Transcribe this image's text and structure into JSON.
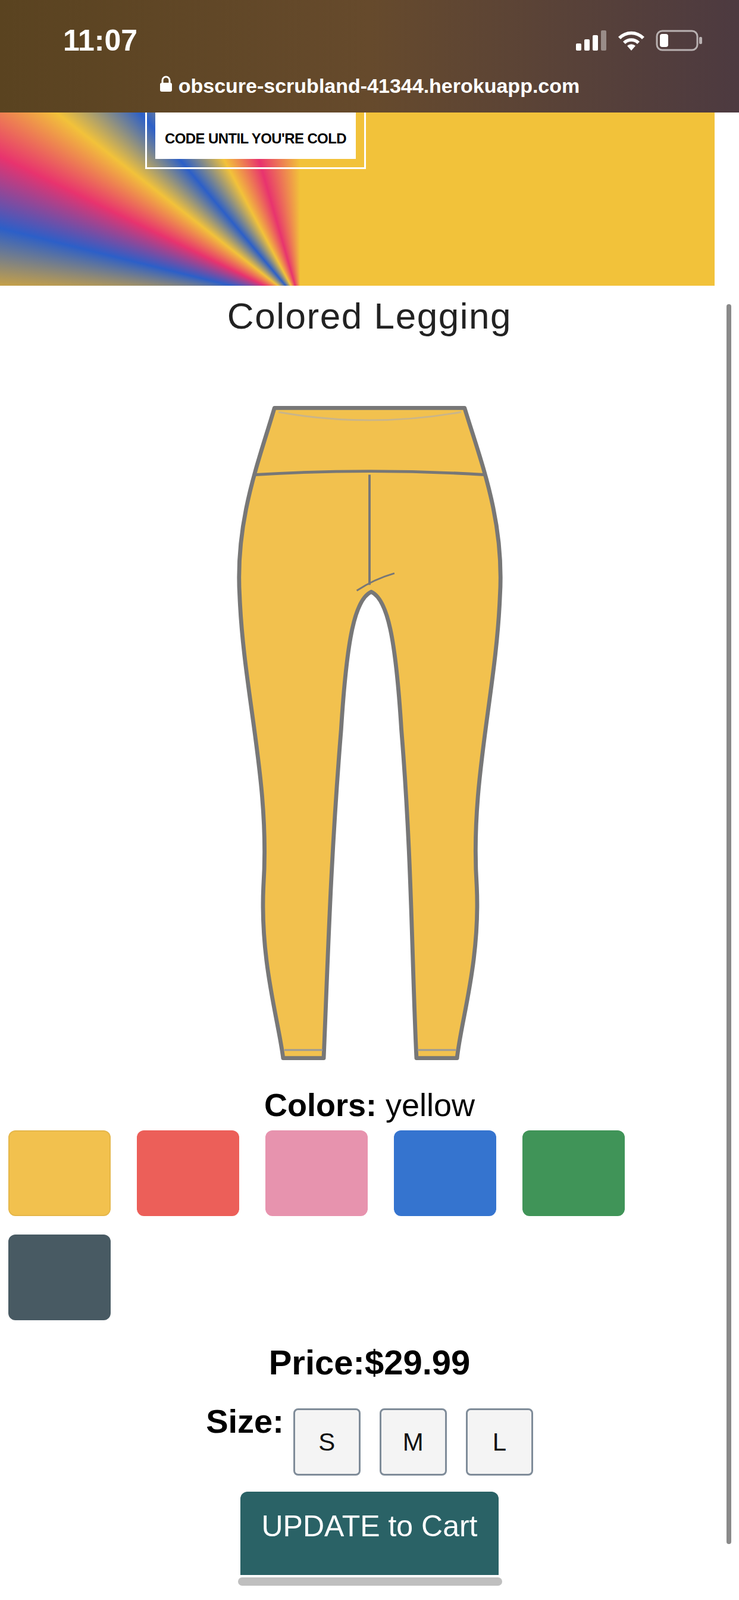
{
  "status_bar": {
    "time": "11:07",
    "url": "obscure-scrubland-41344.herokuapp.com"
  },
  "hero": {
    "logo_text": "CODE UNTIL YOU'RE COLD"
  },
  "product": {
    "title": "Colored Legging",
    "colors_label": "Colors:",
    "color_name": "yellow",
    "swatches": [
      {
        "color": "#f2c14e",
        "selected": true
      },
      {
        "color": "#ec5f59",
        "selected": false
      },
      {
        "color": "#e793ae",
        "selected": false
      },
      {
        "color": "#3574cf",
        "selected": false
      },
      {
        "color": "#409458",
        "selected": false
      },
      {
        "color": "#485a63",
        "selected": false
      }
    ],
    "price_label": "Price:",
    "price": "$29.99",
    "size_label": "Size:",
    "sizes": [
      {
        "label": "S",
        "selected": false
      },
      {
        "label": "M",
        "selected": false
      },
      {
        "label": "L",
        "selected": false
      }
    ],
    "button": "UPDATE to Cart"
  }
}
